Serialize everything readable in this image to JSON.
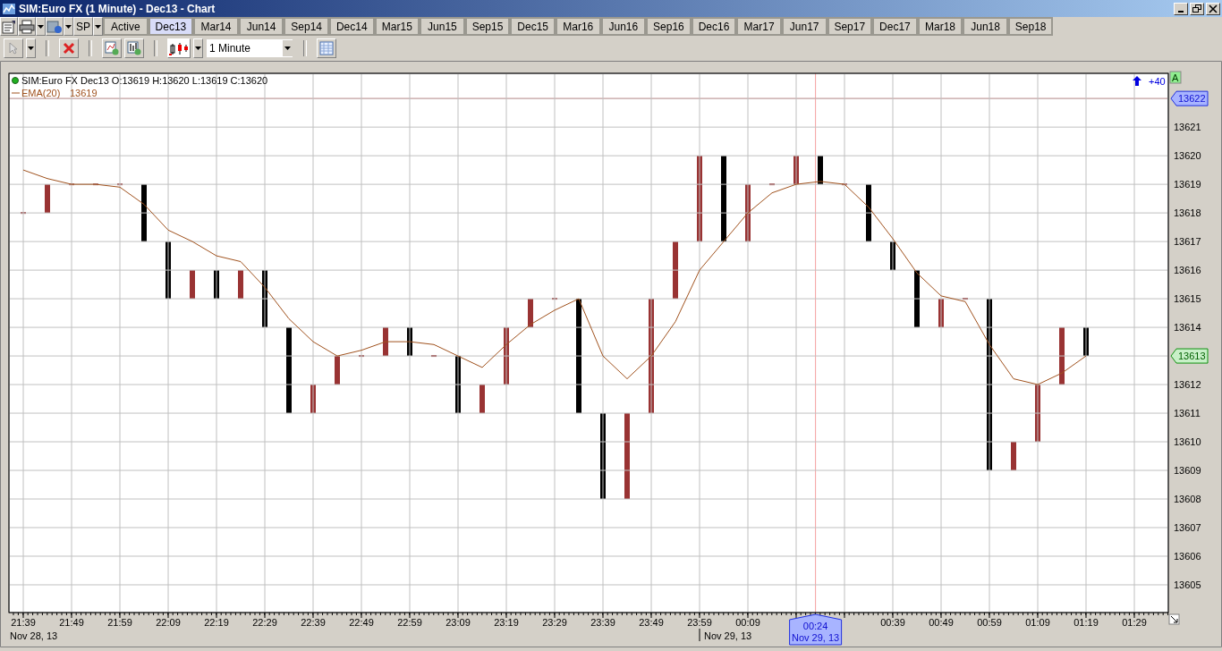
{
  "window": {
    "title": "SIM:Euro FX (1 Minute) - Dec13 - Chart"
  },
  "instrument_menu": {
    "label": "SP"
  },
  "contract_tabs": [
    {
      "label": "Active",
      "selected": false
    },
    {
      "label": "Dec13",
      "selected": true
    },
    {
      "label": "Mar14",
      "selected": false
    },
    {
      "label": "Jun14",
      "selected": false
    },
    {
      "label": "Sep14",
      "selected": false
    },
    {
      "label": "Dec14",
      "selected": false
    },
    {
      "label": "Mar15",
      "selected": false
    },
    {
      "label": "Jun15",
      "selected": false
    },
    {
      "label": "Sep15",
      "selected": false
    },
    {
      "label": "Dec15",
      "selected": false
    },
    {
      "label": "Mar16",
      "selected": false
    },
    {
      "label": "Jun16",
      "selected": false
    },
    {
      "label": "Sep16",
      "selected": false
    },
    {
      "label": "Dec16",
      "selected": false
    },
    {
      "label": "Mar17",
      "selected": false
    },
    {
      "label": "Jun17",
      "selected": false
    },
    {
      "label": "Sep17",
      "selected": false
    },
    {
      "label": "Dec17",
      "selected": false
    },
    {
      "label": "Mar18",
      "selected": false
    },
    {
      "label": "Jun18",
      "selected": false
    },
    {
      "label": "Sep18",
      "selected": false
    }
  ],
  "toolbar": {
    "interval": "1 Minute"
  },
  "chart": {
    "legend": [
      {
        "kind": "instrument",
        "text": "SIM:Euro FX Dec13 O:13619 H:13620 L:13619 C:13620"
      },
      {
        "kind": "indicator",
        "value": "13619"
      }
    ],
    "scroll_offset": "+40",
    "auto_scale": "A",
    "crosshair_price": "13622",
    "last_price": "13613",
    "crosshair_time": "00:24",
    "crosshair_date": "Nov 29, 13",
    "date_labels": [
      "Nov 28, 13",
      "Nov 29, 13"
    ],
    "chart_data": {
      "type": "line",
      "grid": true,
      "ylim": [
        13604.03,
        13622.88
      ],
      "categories": [
        "21:39",
        null,
        "21:49",
        null,
        "21:59",
        null,
        "22:09",
        null,
        "22:19",
        null,
        "22:29",
        null,
        "22:39",
        null,
        "22:49",
        null,
        "22:59",
        null,
        "23:09",
        null,
        "23:19",
        null,
        "23:29",
        null,
        "23:39",
        null,
        "23:49",
        null,
        "23:59",
        null,
        "00:09",
        null,
        null,
        null,
        null,
        null,
        "00:39",
        null,
        "00:49",
        null,
        "00:59",
        null,
        "01:09",
        null,
        "01:19",
        null,
        "01:29"
      ],
      "yticks": [
        13605,
        13606,
        13607,
        13608,
        13609,
        13610,
        13611,
        13612,
        13614,
        13615,
        13616,
        13617,
        13618,
        13619,
        13620,
        13621
      ],
      "series": [
        {
          "name": "EMA(20)",
          "color": "#a0521e",
          "values": [
            13619.5,
            13619.2,
            13619.0,
            13619.0,
            13618.9,
            13618.3,
            13617.4,
            13617.0,
            13616.5,
            13616.3,
            13615.4,
            13614.3,
            13613.5,
            13613.0,
            13613.2,
            13613.5,
            13613.5,
            13613.4,
            13613.0,
            13612.6,
            13613.4,
            13614.1,
            13614.6,
            13615.0,
            13613.0,
            13612.2,
            13613.0,
            13614.2,
            13616.0,
            13617.0,
            13618.0,
            13618.7,
            13619.0,
            13619.1,
            13619.0,
            13618.2,
            13617.1,
            13615.9,
            13615.1,
            13614.9,
            13613.4,
            13612.2,
            13612.0,
            13612.4,
            13613.0,
            null,
            null
          ]
        }
      ]
    }
  }
}
